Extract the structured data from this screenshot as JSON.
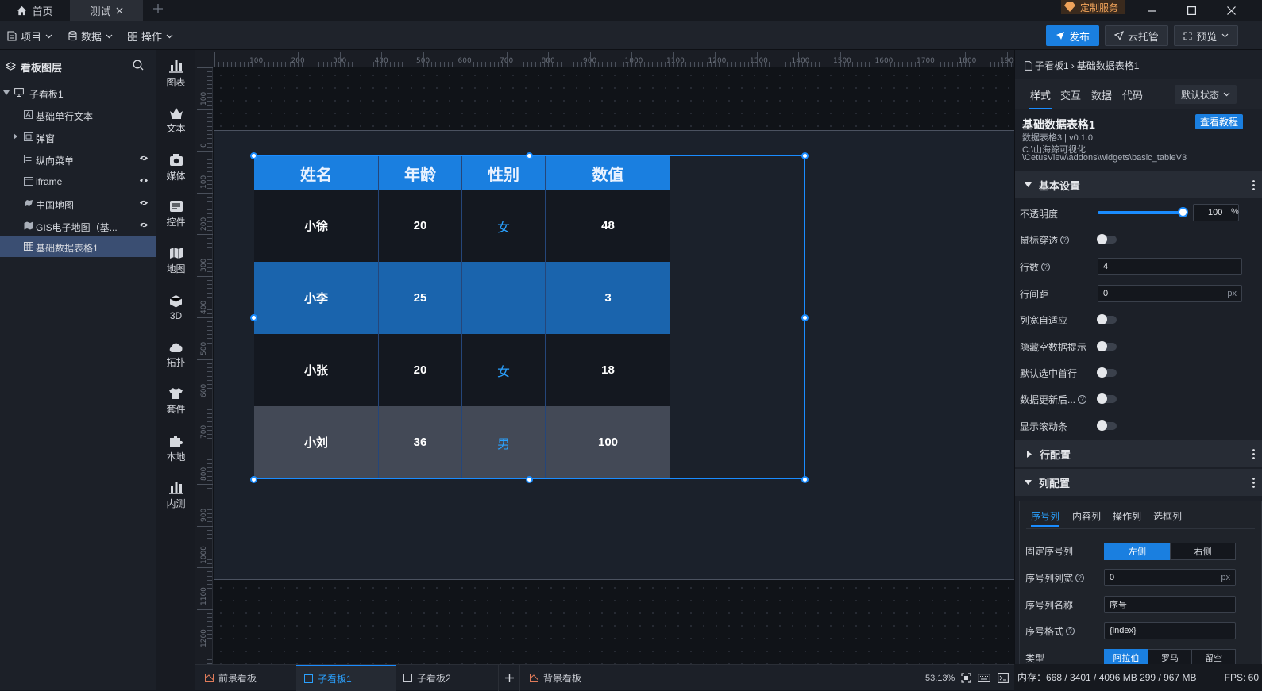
{
  "titlebar": {
    "tabs": [
      {
        "label": "首页",
        "icon": "home-icon"
      },
      {
        "label": "测试",
        "icon": "close-icon"
      }
    ],
    "custom_service": "定制服务"
  },
  "toolbar": {
    "menus": [
      "项目",
      "数据",
      "操作"
    ],
    "publish": "发布",
    "cloud_hosting": "云托管",
    "preview": "预览"
  },
  "layers": {
    "title": "看板图层",
    "items": [
      {
        "label": "子看板1",
        "icon": "board-icon",
        "eye": false
      },
      {
        "label": "基础单行文本",
        "icon": "text-icon",
        "eye": false
      },
      {
        "label": "弹窗",
        "icon": "popup-icon",
        "eye": false
      },
      {
        "label": "纵向菜单",
        "icon": "menu-icon",
        "eye": true
      },
      {
        "label": "iframe",
        "icon": "iframe-icon",
        "eye": true
      },
      {
        "label": "中国地图",
        "icon": "map-icon",
        "eye": true
      },
      {
        "label": "GIS电子地图（基...",
        "icon": "gis-map-icon",
        "eye": true
      },
      {
        "label": "基础数据表格1",
        "icon": "table-icon",
        "eye": false
      }
    ]
  },
  "components": {
    "items": [
      "图表",
      "文本",
      "媒体",
      "控件",
      "地图",
      "3D",
      "拓扑",
      "套件",
      "本地",
      "内测"
    ]
  },
  "ruler": {
    "top": [
      "100",
      "200",
      "300",
      "400",
      "500",
      "600",
      "700",
      "800",
      "900",
      "1000",
      "1100",
      "1200",
      "1300",
      "1400",
      "1500",
      "1600",
      "1700",
      "1800",
      "1900"
    ],
    "left": [
      "100",
      "0",
      "100",
      "200",
      "300",
      "400",
      "500",
      "600",
      "700",
      "800",
      "900",
      "1000",
      "1100",
      "1200"
    ]
  },
  "table": {
    "headers": [
      "姓名",
      "年龄",
      "性别",
      "数值"
    ],
    "rows": [
      {
        "name": "小徐",
        "age": "20",
        "gender": "女",
        "value": "48"
      },
      {
        "name": "小李",
        "age": "25",
        "gender": "",
        "value": "3"
      },
      {
        "name": "小张",
        "age": "20",
        "gender": "女",
        "value": "18"
      },
      {
        "name": "小刘",
        "age": "36",
        "gender": "男",
        "value": "100"
      }
    ],
    "colors": {
      "header": "#1a7fe0",
      "row_dark": "#141820",
      "row_selected": "#1a64ad",
      "row_last": "#434956"
    }
  },
  "bottom_tabs": [
    "前景看板",
    "子看板1",
    "子看板2",
    "背景看板"
  ],
  "zoom": "53.13%",
  "props": {
    "breadcrumb": [
      "子看板1",
      "基础数据表格1"
    ],
    "tabs": [
      "样式",
      "交互",
      "数据",
      "代码"
    ],
    "state_select": "默认状态",
    "widget_title": "基础数据表格1",
    "widget_sub": "数据表格3 | v0.1.0",
    "widget_path1": "C:\\山海鲸可视化",
    "widget_path2": "\\CetusView\\addons\\widgets\\basic_tableV3",
    "tutorial_btn": "查看教程",
    "section_basic": "基本设置",
    "opacity_label": "不透明度",
    "opacity_value": "100",
    "opacity_unit": "%",
    "mouse_through": "鼠标穿透",
    "rows_label": "行数",
    "rows_value": "4",
    "row_gap_label": "行间距",
    "row_gap_value": "0",
    "px": "px",
    "col_auto": "列宽自适应",
    "hide_empty": "隐藏空数据提示",
    "select_first": "默认选中首行",
    "data_update": "数据更新后...",
    "show_scroll": "显示滚动条",
    "section_row": "行配置",
    "section_col": "列配置",
    "col_tabs": [
      "序号列",
      "内容列",
      "操作列",
      "选框列"
    ],
    "fix_index": "固定序号列",
    "left_side": "左侧",
    "right_side": "右侧",
    "index_width_label": "序号列列宽",
    "index_width_value": "0",
    "index_name_label": "序号列名称",
    "index_name_value": "序号",
    "index_format_label": "序号格式",
    "index_format_value": "{index}",
    "type_label": "类型",
    "type_options": [
      "阿拉伯",
      "罗马",
      "留空"
    ]
  },
  "status": {
    "memory": "内存：668 / 3401 / 4096 MB  299 / 967 MB",
    "fps": "FPS: 60"
  }
}
